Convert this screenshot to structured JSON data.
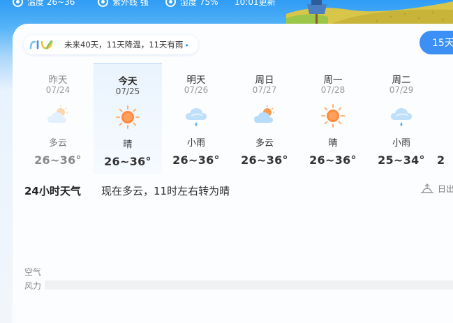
{
  "top_strip": {
    "items": [
      {
        "icon": "thermometer-icon",
        "text": "温度 26~36"
      },
      {
        "icon": "ultraviolet-icon",
        "text": "紫外线 强"
      },
      {
        "icon": "humidity-icon",
        "text": "湿度 75%"
      },
      {
        "icon": "",
        "text": "10:01更新"
      }
    ]
  },
  "forecast_banner": {
    "text": "未来40天，11天降温，11天有雨",
    "arrow": "▸"
  },
  "forecast_15_button": "15天",
  "days": [
    {
      "name": "昨天",
      "date": "07/24",
      "icon": "partly-cloudy-icon",
      "condition": "多云",
      "temp": "26~36°"
    },
    {
      "name": "今天",
      "date": "07/25",
      "icon": "sunny-icon",
      "condition": "晴",
      "temp": "26~36°"
    },
    {
      "name": "明天",
      "date": "07/26",
      "icon": "light-rain-icon",
      "condition": "小雨",
      "temp": "26~36°"
    },
    {
      "name": "周日",
      "date": "07/27",
      "icon": "partly-cloudy-icon",
      "condition": "多云",
      "temp": "26~36°"
    },
    {
      "name": "周一",
      "date": "07/28",
      "icon": "sunny-icon",
      "condition": "晴",
      "temp": "26~36°"
    },
    {
      "name": "周二",
      "date": "07/29",
      "icon": "light-rain-icon",
      "condition": "小雨",
      "temp": "25~34°"
    },
    {
      "name": "",
      "date": "",
      "icon": "",
      "condition": "",
      "temp": "2"
    }
  ],
  "hourly": {
    "title": "24小时天气",
    "description": "现在多云，11时左右转为晴",
    "sunrise_label": "日出",
    "air_label": "空气",
    "wind_label": "风力"
  },
  "colors": {
    "accent": "#3c8ff5",
    "sun": "#ff8a3d",
    "cloud": "#bfe0fb",
    "rain": "#5bb0f2"
  }
}
